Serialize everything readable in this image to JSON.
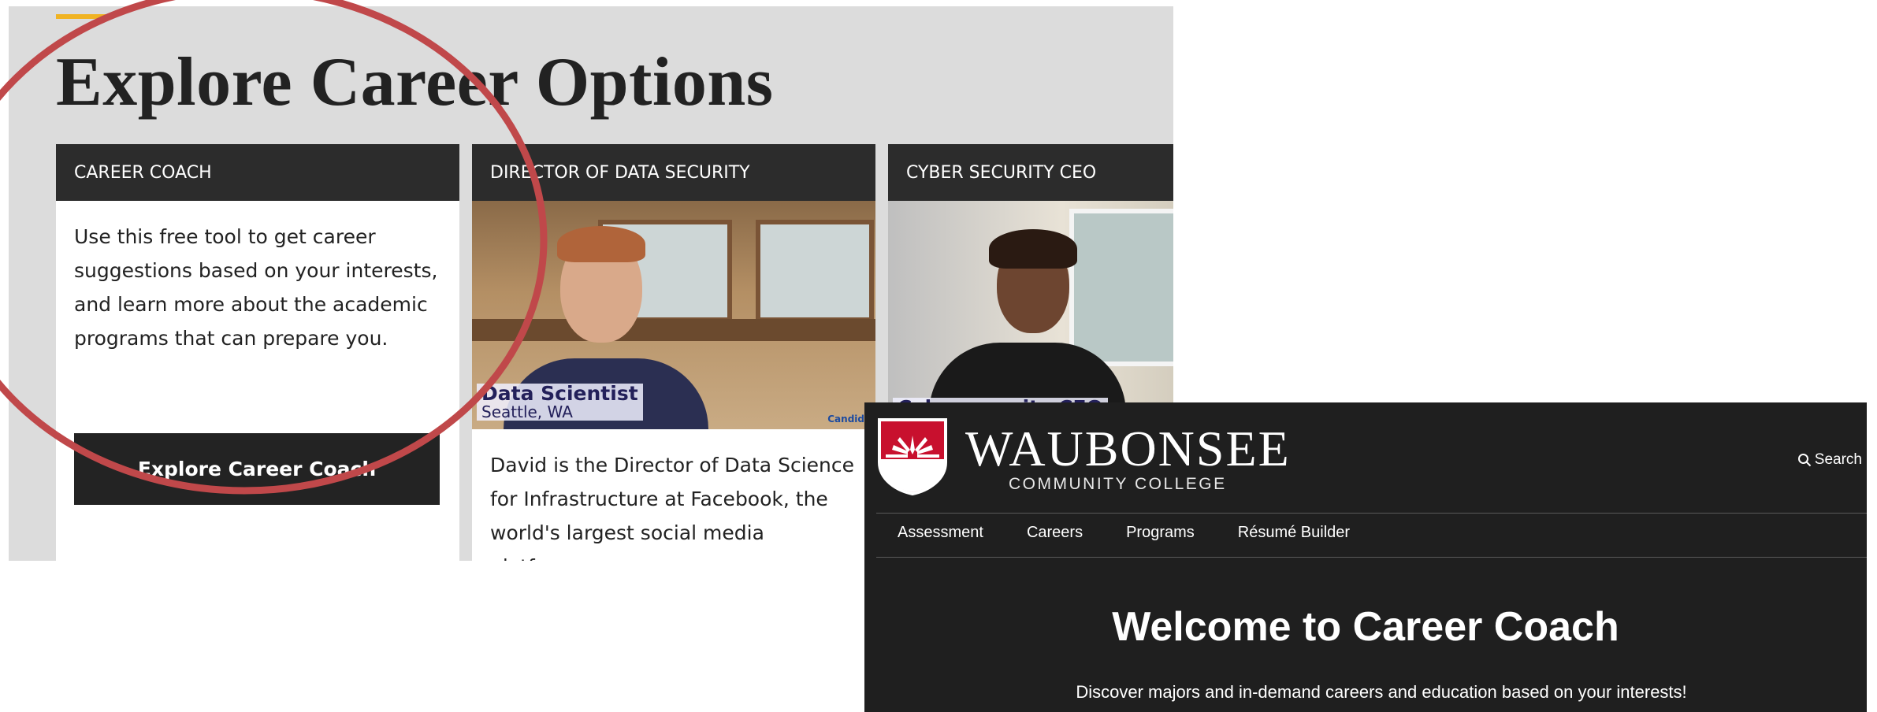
{
  "explore": {
    "title": "Explore Career Options",
    "accent_color": "#f0b323",
    "cards": [
      {
        "heading": "CAREER COACH",
        "body": "Use this free tool to get career suggestions based on your interests, and learn more about the academic programs that can prepare you.",
        "button_label": "Explore Career Coach"
      },
      {
        "heading": "DIRECTOR OF DATA SECURITY",
        "video_caption_title": "Data Scientist",
        "video_caption_sub": "Seattle, WA",
        "video_watermark": "Candid",
        "body": "David is the Director of Data Science for Infrastructure at Facebook, the world's largest social media platform."
      },
      {
        "heading": "CYBER SECURITY CEO",
        "video_caption_title": "Cybersecurity CEO"
      }
    ]
  },
  "annotation": {
    "circle_color": "#c0484a"
  },
  "career_coach_site": {
    "brand_name": "WAUBONSEE",
    "brand_subtitle": "COMMUNITY COLLEGE",
    "search_label": "Search",
    "nav": [
      "Assessment",
      "Careers",
      "Programs",
      "Résumé Builder"
    ],
    "welcome_title": "Welcome to Career Coach",
    "welcome_subtitle": "Discover majors and in-demand careers and education based on your interests!",
    "brand_red": "#c8102e"
  }
}
